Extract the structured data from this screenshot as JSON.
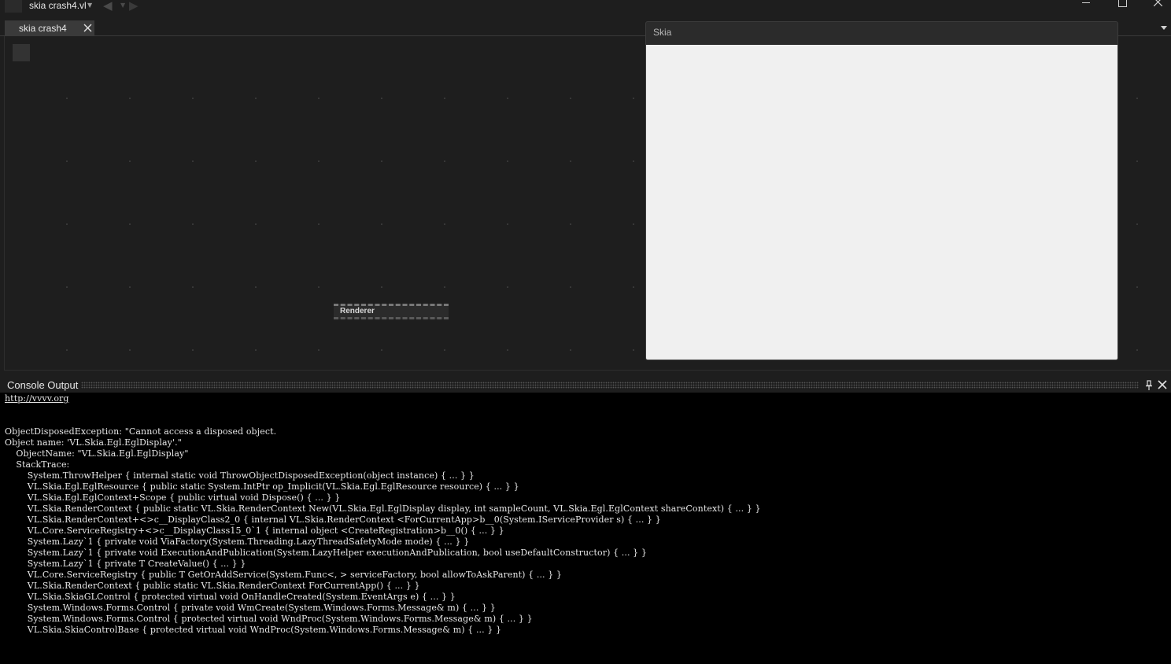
{
  "window": {
    "document_title": "skia crash4.vl"
  },
  "tabs": [
    {
      "label": "skia crash4"
    }
  ],
  "patch": {
    "node_label": "Renderer"
  },
  "skia_window": {
    "title": "Skia"
  },
  "console": {
    "title": "Console Output",
    "link": "http://vvvv.org",
    "lines": [
      "",
      "",
      "ObjectDisposedException: \"Cannot access a disposed object.",
      "Object name: 'VL.Skia.Egl.EglDisplay'.\"",
      "    ObjectName: \"VL.Skia.Egl.EglDisplay\"",
      "    StackTrace:",
      "        System.ThrowHelper { internal static void ThrowObjectDisposedException(object instance) { ... } }",
      "        VL.Skia.Egl.EglResource { public static System.IntPtr op_Implicit(VL.Skia.Egl.EglResource resource) { ... } }",
      "        VL.Skia.Egl.EglContext+Scope { public virtual void Dispose() { ... } }",
      "        VL.Skia.RenderContext { public static VL.Skia.RenderContext New(VL.Skia.Egl.EglDisplay display, int sampleCount, VL.Skia.Egl.EglContext shareContext) { ... } }",
      "        VL.Skia.RenderContext+<>c__DisplayClass2_0 { internal VL.Skia.RenderContext <ForCurrentApp>b__0(System.IServiceProvider s) { ... } }",
      "        VL.Core.ServiceRegistry+<>c__DisplayClass15_0`1 { internal object <CreateRegistration>b__0() { ... } }",
      "        System.Lazy`1 { private void ViaFactory(System.Threading.LazyThreadSafetyMode mode) { ... } }",
      "        System.Lazy`1 { private void ExecutionAndPublication(System.LazyHelper executionAndPublication, bool useDefaultConstructor) { ... } }",
      "        System.Lazy`1 { private T CreateValue() { ... } }",
      "        VL.Core.ServiceRegistry { public T GetOrAddService(System.Func<, > serviceFactory, bool allowToAskParent) { ... } }",
      "        VL.Skia.RenderContext { public static VL.Skia.RenderContext ForCurrentApp() { ... } }",
      "        VL.Skia.SkiaGLControl { protected virtual void OnHandleCreated(System.EventArgs e) { ... } }",
      "        System.Windows.Forms.Control { private void WmCreate(System.Windows.Forms.Message& m) { ... } }",
      "        System.Windows.Forms.Control { protected virtual void WndProc(System.Windows.Forms.Message& m) { ... } }",
      "        VL.Skia.SkiaControlBase { protected virtual void WndProc(System.Windows.Forms.Message& m) { ... } }"
    ]
  }
}
